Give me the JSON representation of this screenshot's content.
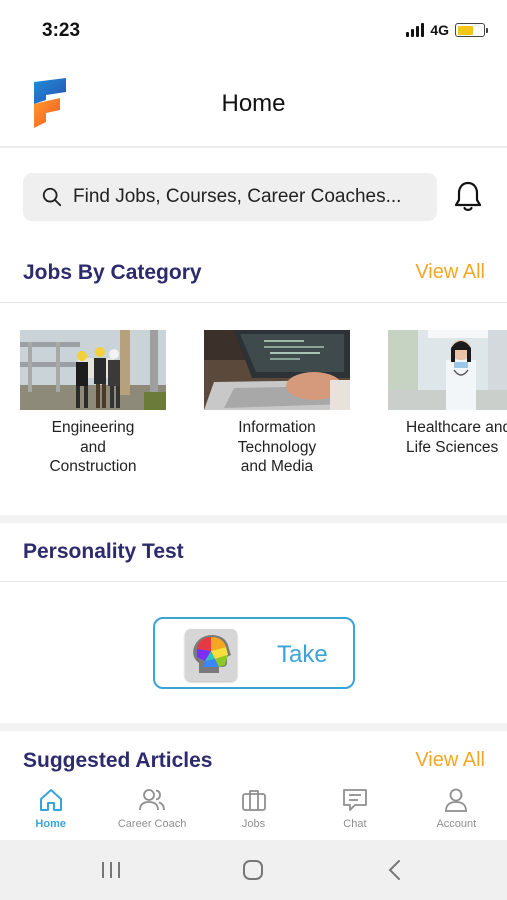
{
  "status": {
    "time": "3:23",
    "network": "4G",
    "battery_level": 0.6
  },
  "header": {
    "title": "Home"
  },
  "search": {
    "placeholder": "Find Jobs, Courses, Career Coaches..."
  },
  "jobs_section": {
    "title": "Jobs By Category",
    "view_all": "View All",
    "categories": [
      {
        "label_lines": [
          "Engineering",
          "and",
          "Construction"
        ]
      },
      {
        "label_lines": [
          "Information",
          "Technology",
          "and Media"
        ]
      },
      {
        "label_lines": [
          "Healthcare and",
          "Life Sciences"
        ]
      }
    ]
  },
  "personality": {
    "title": "Personality Test",
    "button_label": "Take"
  },
  "articles": {
    "title": "Suggested Articles",
    "view_all": "View All"
  },
  "tabbar": {
    "items": [
      {
        "label": "Home",
        "icon": "home-icon",
        "active": true
      },
      {
        "label": "Career Coach",
        "icon": "people-icon",
        "active": false
      },
      {
        "label": "Jobs",
        "icon": "briefcase-icon",
        "active": false
      },
      {
        "label": "Chat",
        "icon": "chat-icon",
        "active": false
      },
      {
        "label": "Account",
        "icon": "user-icon",
        "active": false
      }
    ]
  },
  "colors": {
    "accent": "#3aa3d8",
    "heading": "#2d2a6e",
    "link": "#f5a623"
  }
}
